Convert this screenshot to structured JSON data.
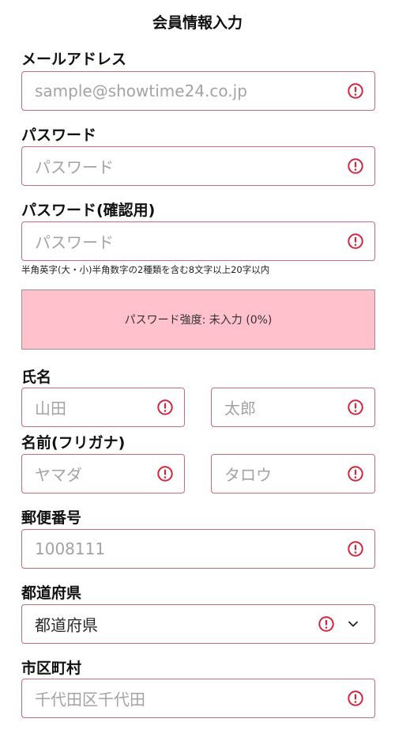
{
  "page": {
    "title": "会員情報入力"
  },
  "email": {
    "label": "メールアドレス",
    "placeholder": "sample@showtime24.co.jp"
  },
  "password": {
    "label": "パスワード",
    "placeholder": "パスワード"
  },
  "password_confirm": {
    "label": "パスワード(確認用)",
    "placeholder": "パスワード",
    "hint": "半角英字(大・小)半角数字の2種類を含む8文字以上20字以内"
  },
  "strength": {
    "text": "パスワード強度: 未入力 (0%)"
  },
  "name": {
    "label": "氏名",
    "last_placeholder": "山田",
    "first_placeholder": "太郎"
  },
  "kana": {
    "label": "名前(フリガナ)",
    "last_placeholder": "ヤマダ",
    "first_placeholder": "タロウ"
  },
  "postal": {
    "label": "郵便番号",
    "placeholder": "1008111"
  },
  "prefecture": {
    "label": "都道府県",
    "selected": "都道府県"
  },
  "city": {
    "label": "市区町村",
    "placeholder": "千代田区千代田"
  },
  "colors": {
    "error": "#d0273e",
    "border": "#c86b7b",
    "strength_bg": "#ffc2cd"
  },
  "icons": {
    "error": "exclamation-circle-icon",
    "dropdown": "chevron-down-icon"
  }
}
